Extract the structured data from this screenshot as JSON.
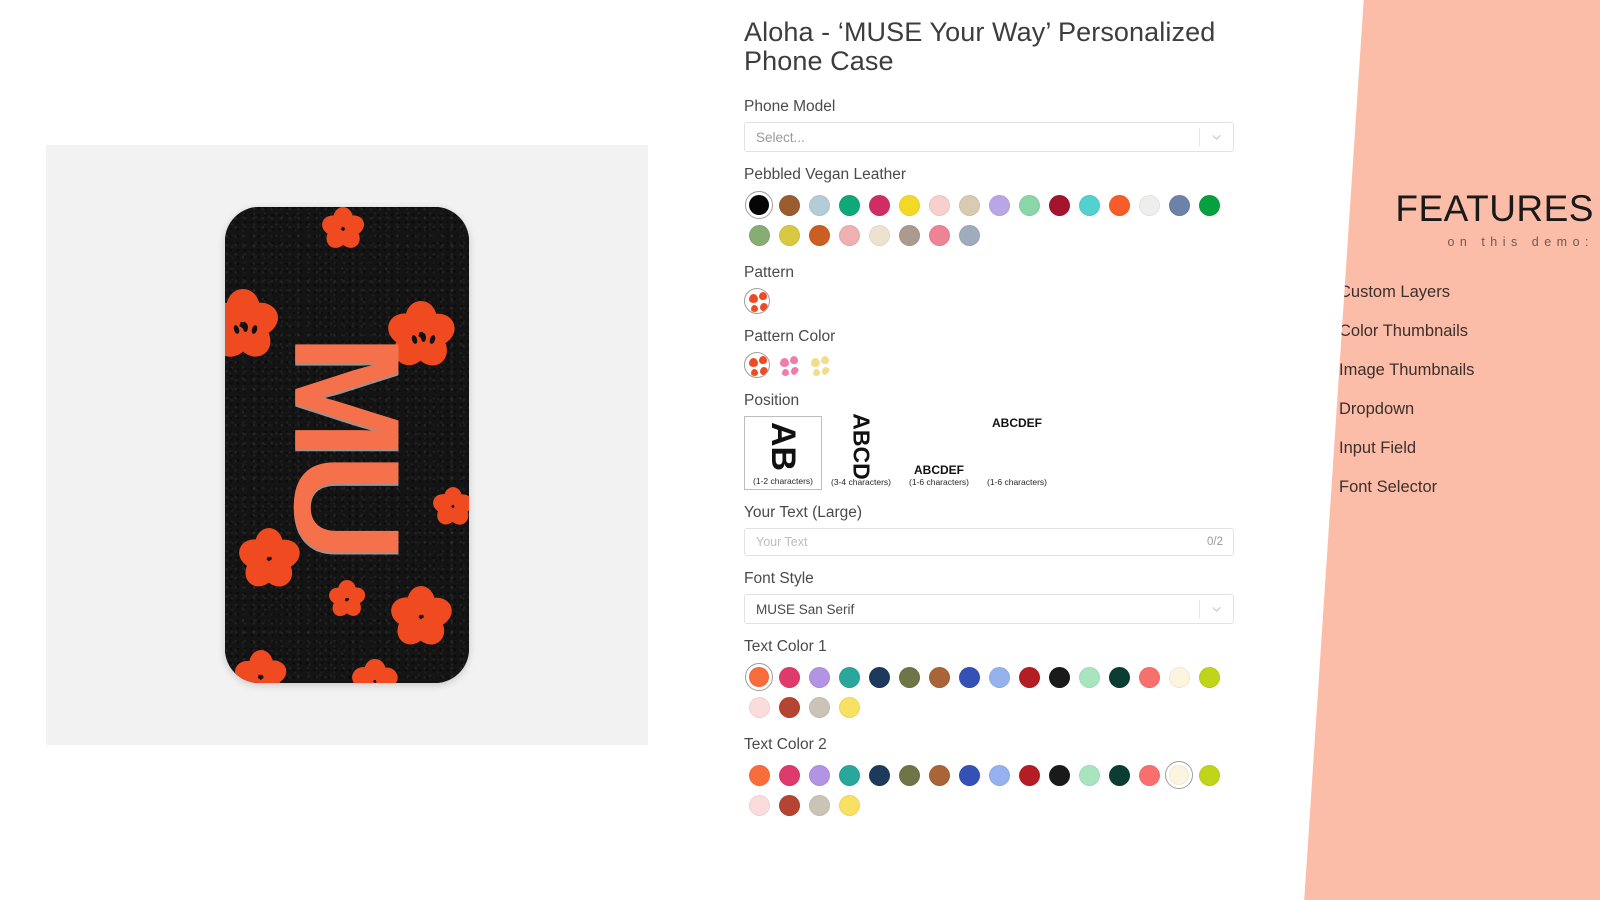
{
  "product": {
    "title": "Aloha - ‘MUSE Your Way’ Personalized Phone Case",
    "preview_monogram": "MU"
  },
  "phone_model": {
    "label": "Phone Model",
    "placeholder": "Select...",
    "value": "Select...",
    "chevron_icon": "chevron-down-icon"
  },
  "material": {
    "label": "Pebbled Vegan Leather",
    "selected_index": 0,
    "swatches": [
      {
        "name": "Black",
        "hex": "#050505"
      },
      {
        "name": "Brown",
        "hex": "#9b5c30"
      },
      {
        "name": "Light Blue",
        "hex": "#b4ccd6"
      },
      {
        "name": "Emerald",
        "hex": "#0fa878"
      },
      {
        "name": "Magenta",
        "hex": "#d12d65"
      },
      {
        "name": "Yellow",
        "hex": "#f4d924"
      },
      {
        "name": "Blush Pink",
        "hex": "#f7cfcd"
      },
      {
        "name": "Sand",
        "hex": "#d9cbb2"
      },
      {
        "name": "Lilac",
        "hex": "#b9a6e6"
      },
      {
        "name": "Mint",
        "hex": "#8bd6a8"
      },
      {
        "name": "Wine",
        "hex": "#a4142e"
      },
      {
        "name": "Turquoise",
        "hex": "#53d0d0"
      },
      {
        "name": "Orange",
        "hex": "#f75c2a"
      },
      {
        "name": "Off White",
        "hex": "#eeeeec"
      },
      {
        "name": "Slate Blue",
        "hex": "#6c82a8"
      },
      {
        "name": "Green",
        "hex": "#06a13f"
      },
      {
        "name": "Sage",
        "hex": "#87ad75"
      },
      {
        "name": "Ochre",
        "hex": "#d9c842"
      },
      {
        "name": "Rust",
        "hex": "#cb5e22"
      },
      {
        "name": "Rose",
        "hex": "#eeb0b0"
      },
      {
        "name": "Cream",
        "hex": "#ece3cf"
      },
      {
        "name": "Taupe",
        "hex": "#ab9a8e"
      },
      {
        "name": "Pink",
        "hex": "#ef8396"
      },
      {
        "name": "Blue Gray",
        "hex": "#a0acbd"
      }
    ]
  },
  "pattern": {
    "label": "Pattern",
    "selected_index": 0,
    "options": [
      {
        "name": "Aloha Flowers",
        "hex": "#ef4a20"
      }
    ]
  },
  "pattern_color": {
    "label": "Pattern Color",
    "selected_index": 0,
    "options": [
      {
        "name": "Orange Flowers",
        "hex": "#ef4a20"
      },
      {
        "name": "Pink Flowers",
        "hex": "#f07cab"
      },
      {
        "name": "Yellow Flowers",
        "hex": "#f2dd8a"
      }
    ]
  },
  "position": {
    "label": "Position",
    "selected_index": 0,
    "options": [
      {
        "sample": "AB",
        "caption": "(1-2 characters)",
        "rotated": true,
        "size": 34
      },
      {
        "sample": "ABCD",
        "caption": "(3-4 characters)",
        "rotated": true,
        "size": 23
      },
      {
        "sample": "ABCDEF",
        "caption": "(1-6 characters)",
        "rotated": false,
        "size": 12
      },
      {
        "sample": "ABCDEF",
        "caption": "(1-6 characters)",
        "rotated": false,
        "size": 12
      }
    ]
  },
  "your_text": {
    "label": "Your Text (Large)",
    "placeholder": "Your Text",
    "value": "",
    "counter": "0/2"
  },
  "font_style": {
    "label": "Font Style",
    "value": "MUSE San Serif",
    "chevron_icon": "chevron-down-icon"
  },
  "text_color_1": {
    "label": "Text Color 1",
    "selected_index": 0,
    "swatches": [
      {
        "name": "Coral Orange",
        "hex": "#f96d3c"
      },
      {
        "name": "Raspberry",
        "hex": "#de3a6b"
      },
      {
        "name": "Lilac",
        "hex": "#b393e3"
      },
      {
        "name": "Teal",
        "hex": "#2aa79b"
      },
      {
        "name": "Navy",
        "hex": "#1d3a5c"
      },
      {
        "name": "Olive",
        "hex": "#6f7547"
      },
      {
        "name": "Brown",
        "hex": "#a96437"
      },
      {
        "name": "Royal Blue",
        "hex": "#3551b5"
      },
      {
        "name": "Sky Blue",
        "hex": "#95b2ee"
      },
      {
        "name": "Red",
        "hex": "#b51d24"
      },
      {
        "name": "Black",
        "hex": "#1a1a1a"
      },
      {
        "name": "Mint",
        "hex": "#a8e5bf"
      },
      {
        "name": "Dark Green",
        "hex": "#0b3d34"
      },
      {
        "name": "Salmon",
        "hex": "#f8706e"
      },
      {
        "name": "Ivory",
        "hex": "#fbf4de"
      },
      {
        "name": "Lime",
        "hex": "#c0d41a"
      },
      {
        "name": "Pale Pink",
        "hex": "#fbdcdd"
      },
      {
        "name": "Brick",
        "hex": "#b54432"
      },
      {
        "name": "Warm Gray",
        "hex": "#c9c4b6"
      },
      {
        "name": "Yellow",
        "hex": "#f8e062"
      }
    ]
  },
  "text_color_2": {
    "label": "Text Color 2",
    "selected_index": 14,
    "swatches": [
      {
        "name": "Coral Orange",
        "hex": "#f96d3c"
      },
      {
        "name": "Raspberry",
        "hex": "#de3a6b"
      },
      {
        "name": "Lilac",
        "hex": "#b393e3"
      },
      {
        "name": "Teal",
        "hex": "#2aa79b"
      },
      {
        "name": "Navy",
        "hex": "#1d3a5c"
      },
      {
        "name": "Olive",
        "hex": "#6f7547"
      },
      {
        "name": "Brown",
        "hex": "#a96437"
      },
      {
        "name": "Royal Blue",
        "hex": "#3551b5"
      },
      {
        "name": "Sky Blue",
        "hex": "#95b2ee"
      },
      {
        "name": "Red",
        "hex": "#b51d24"
      },
      {
        "name": "Black",
        "hex": "#1a1a1a"
      },
      {
        "name": "Mint",
        "hex": "#a8e5bf"
      },
      {
        "name": "Dark Green",
        "hex": "#0b3d34"
      },
      {
        "name": "Salmon",
        "hex": "#f8706e"
      },
      {
        "name": "Ivory",
        "hex": "#fbf4de"
      },
      {
        "name": "Lime",
        "hex": "#c0d41a"
      },
      {
        "name": "Pale Pink",
        "hex": "#fbdcdd"
      },
      {
        "name": "Brick",
        "hex": "#b54432"
      },
      {
        "name": "Warm Gray",
        "hex": "#c9c4b6"
      },
      {
        "name": "Yellow",
        "hex": "#f8e062"
      }
    ]
  },
  "features_panel": {
    "background_hex": "#fcbda8",
    "title": "FEATURES",
    "subtitle": "on this demo:",
    "items": [
      "Custom Layers",
      "Color Thumbnails",
      "Image Thumbnails",
      "Dropdown",
      "Input Field",
      "Font Selector"
    ]
  }
}
